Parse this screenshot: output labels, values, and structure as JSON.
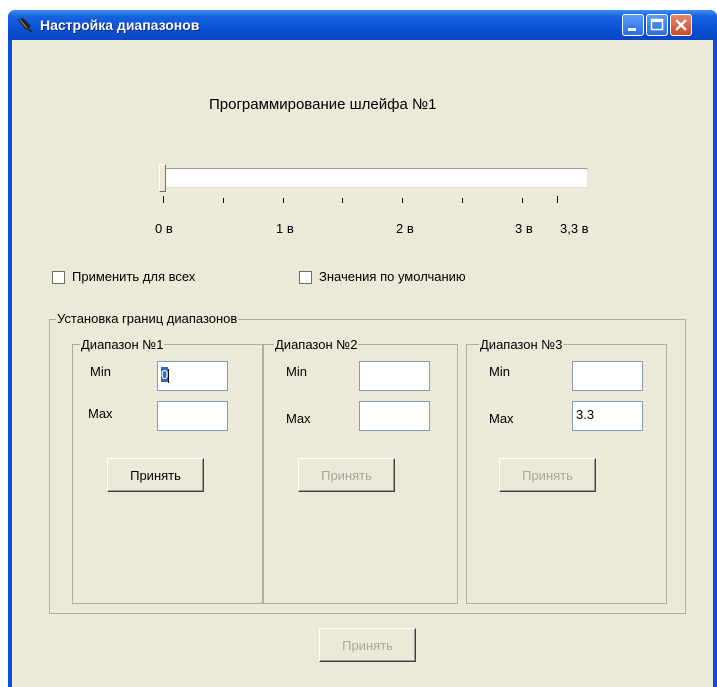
{
  "window": {
    "title": "Настройка диапазонов"
  },
  "slider": {
    "heading": "Программирование шлейфа №1",
    "tick_labels": [
      "0 в",
      "1 в",
      "2 в",
      "3 в",
      "3,3 в"
    ],
    "value": 0,
    "range": [
      0,
      3.3
    ]
  },
  "options": {
    "apply_all_label": "Применить для всех",
    "apply_all_checked": false,
    "defaults_label": "Значения по умолчанию",
    "defaults_checked": false
  },
  "bounds_group": {
    "legend": "Установка  границ диапазонов",
    "ranges": [
      {
        "legend": "Диапазон №1",
        "min_label": "Min",
        "max_label": "Max",
        "min_value": "0",
        "max_value": "",
        "button": "Принять",
        "button_enabled": true
      },
      {
        "legend": "Диапазон №2",
        "min_label": "Min",
        "max_label": "Max",
        "min_value": "",
        "max_value": "",
        "button": "Принять",
        "button_enabled": false
      },
      {
        "legend": "Диапазон №3",
        "min_label": "Min",
        "max_label": "Max",
        "min_value": "",
        "max_value": "3.3",
        "button": "Принять",
        "button_enabled": false
      }
    ]
  },
  "footer": {
    "accept_button": "Принять",
    "accept_enabled": false
  },
  "colors": {
    "titlebar": "#0a52d5",
    "dialog_bg": "#ece9d8",
    "close_button": "#cf4a25",
    "disabled_text": "#a8a59a"
  }
}
